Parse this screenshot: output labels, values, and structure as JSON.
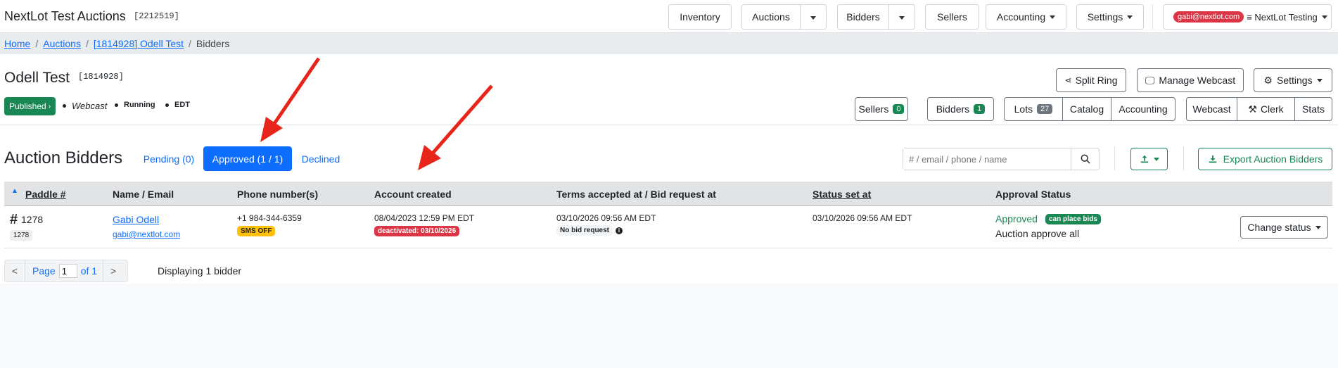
{
  "topnav": {
    "brand": "NextLot Test Auctions",
    "brand_id": "[2212519]",
    "inventory": "Inventory",
    "auctions": "Auctions",
    "bidders": "Bidders",
    "sellers": "Sellers",
    "accounting": "Accounting",
    "settings": "Settings",
    "user_email": "gabi@nextlot.com",
    "user_org": "≡ NextLot Testing"
  },
  "breadcrumb": {
    "home": "Home",
    "auctions": "Auctions",
    "auction": "[1814928] Odell Test",
    "current": "Bidders",
    "sep": "/"
  },
  "auction_header": {
    "title": "Odell Test",
    "id": "[1814928]",
    "published": "Published",
    "webcast": "Webcast",
    "running": "Running",
    "timezone": "EDT",
    "split_ring": "Split Ring",
    "manage_webcast": "Manage Webcast",
    "settings": "Settings",
    "sellers": "Sellers",
    "sellers_count": "0",
    "bidders": "Bidders",
    "bidders_count": "1",
    "lots": "Lots",
    "lots_count": "27",
    "catalog": "Catalog",
    "accounting": "Accounting",
    "webcast_btn": "Webcast",
    "clerk": "Clerk",
    "stats": "Stats"
  },
  "bidders_section": {
    "title": "Auction Bidders",
    "tab_pending": "Pending (0)",
    "tab_approved": "Approved (1 / 1)",
    "tab_declined": "Declined",
    "search_placeholder": "# / email / phone / name",
    "export": "Export Auction Bidders",
    "columns": {
      "paddle": "Paddle #",
      "name": "Name / Email",
      "phone": "Phone number(s)",
      "account": "Account created",
      "terms": "Terms accepted at / Bid request at",
      "status_set": "Status set at",
      "approval": "Approval Status"
    },
    "rows": [
      {
        "paddle_hash": "#",
        "paddle": "1278",
        "paddle_sub": "1278",
        "name": "Gabi Odell",
        "email": "gabi@nextlot.com",
        "phone": "+1 984-344-6359",
        "sms": "SMS OFF",
        "account_created": "08/04/2023 12:59 PM EDT",
        "deactivated": "deactivated: 03/10/2026",
        "terms_at": "03/10/2026 09:56 AM EDT",
        "bid_request": "No bid request",
        "status_set_at": "03/10/2026 09:56 AM EDT",
        "approval": "Approved",
        "can_bid": "can place bids",
        "approval_note": "Auction approve all",
        "change_status": "Change status"
      }
    ]
  },
  "pager": {
    "prev": "<",
    "page_label": "Page",
    "page_value": "1",
    "of_label": "of 1",
    "next": ">",
    "displaying": "Displaying 1 bidder"
  },
  "colors": {
    "primary": "#0d6efd",
    "success": "#198754",
    "danger": "#dc3545",
    "warning": "#ffc107",
    "annotation_arrow": "#e8251a"
  }
}
